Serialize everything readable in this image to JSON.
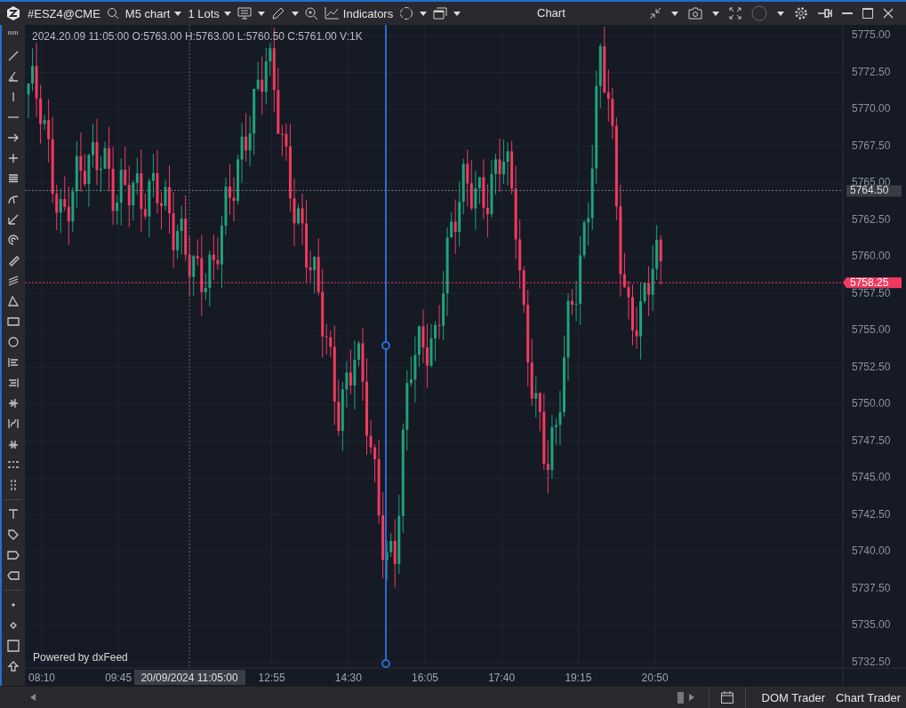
{
  "toolbar": {
    "symbol": "#ESZ4@CME",
    "timeframe": "M5 chart",
    "lots": "1 Lots",
    "indicators": "Indicators"
  },
  "window": {
    "title": "Chart"
  },
  "chart": {
    "ohlc_info": "2024.20.09 11:05:00 O:5763.00 H:5763.00 L:5760.50 C:5761.00 V:1K",
    "watermark": "Powered by dxFeed",
    "price_ticks": [
      "5775.00",
      "5772.50",
      "5770.00",
      "5767.50",
      "5765.00",
      "5762.50",
      "5760.00",
      "5757.50",
      "5755.00",
      "5752.50",
      "5750.00",
      "5747.50",
      "5745.00",
      "5742.50",
      "5740.00",
      "5737.50",
      "5735.00",
      "5732.50"
    ],
    "time_ticks": [
      "08:10",
      "09:45",
      "12:55",
      "14:30",
      "16:05",
      "17:40",
      "19:15",
      "20:50"
    ],
    "last_price": "5758.25",
    "crosshair_price": "5764.50",
    "crosshair_time": "20/09/2024 11:05:00"
  },
  "bottom_bar": {
    "buttons": [
      "DOM Trader",
      "Chart Trader"
    ]
  }
}
